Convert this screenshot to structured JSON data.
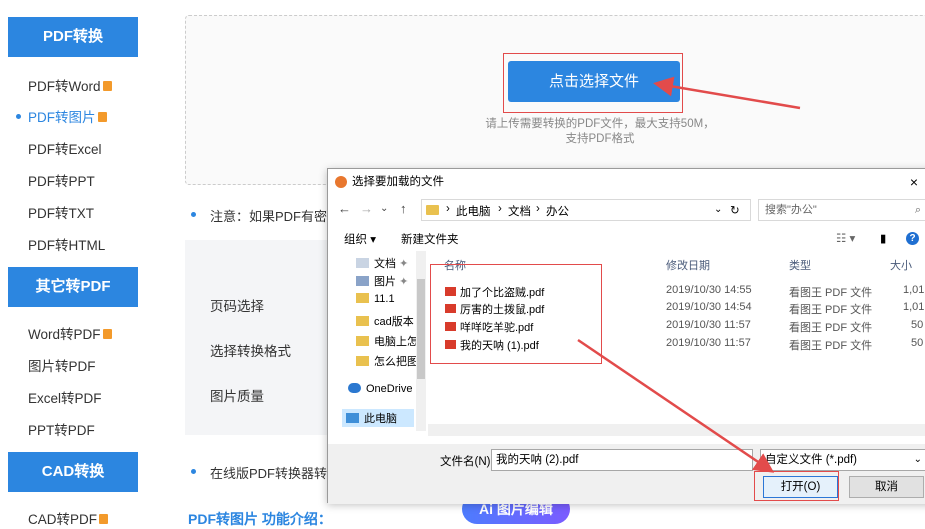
{
  "sidebar": {
    "sections": [
      {
        "title": "PDF转换",
        "items": [
          "PDF转Word",
          "PDF转图片",
          "PDF转Excel",
          "PDF转PPT",
          "PDF转TXT",
          "PDF转HTML"
        ]
      },
      {
        "title": "其它转PDF",
        "items": [
          "Word转PDF",
          "图片转PDF",
          "Excel转PDF",
          "PPT转PDF"
        ]
      },
      {
        "title": "CAD转换",
        "items": [
          "CAD转PDF"
        ]
      }
    ]
  },
  "upload": {
    "button_label": "点击选择文件",
    "hint_line1": "请上传需要转换的PDF文件，最大支持50M，",
    "hint_line2": "支持PDF格式"
  },
  "notes": {
    "note1": "注意：如果PDF有密",
    "note2": "在线版PDF转换器转"
  },
  "settings": {
    "page_select": "页码选择",
    "format_select": "选择转换格式",
    "image_quality": "图片质量"
  },
  "ai_badge": "Ai 图片编辑",
  "bottom_title": "PDF转图片 功能介绍：",
  "dialog": {
    "title": "选择要加载的文件",
    "close": "×",
    "breadcrumbs": [
      "此电脑",
      "文档",
      "办公"
    ],
    "search_placeholder": "搜索\"办公\"",
    "toolbar": {
      "organize": "组织 ▾",
      "new_folder": "新建文件夹"
    },
    "nav_items": [
      "文档",
      "图片",
      "11.1",
      "cad版本",
      "电脑上怎",
      "怎么把图",
      "OneDrive",
      "此电脑"
    ],
    "columns": [
      "名称",
      "修改日期",
      "类型",
      "大小"
    ],
    "files": [
      {
        "name": "加了个比盗贼.pdf",
        "date": "2019/10/30 14:55",
        "type": "看图王 PDF 文件",
        "size": "1,01"
      },
      {
        "name": "厉害的土拨鼠.pdf",
        "date": "2019/10/30 14:54",
        "type": "看图王 PDF 文件",
        "size": "1,01"
      },
      {
        "name": "咩咩吃羊驼.pdf",
        "date": "2019/10/30 11:57",
        "type": "看图王 PDF 文件",
        "size": "50"
      },
      {
        "name": "我的天呐 (1).pdf",
        "date": "2019/10/30 11:57",
        "type": "看图王 PDF 文件",
        "size": "50"
      }
    ],
    "filename_label": "文件名(N):",
    "filename_value": "我的天呐 (2).pdf",
    "filetype_value": "自定义文件 (*.pdf)",
    "open_label": "打开(O)",
    "cancel_label": "取消"
  },
  "colors": {
    "accent": "#2c86e0",
    "annotation_red": "#e24b4b"
  }
}
